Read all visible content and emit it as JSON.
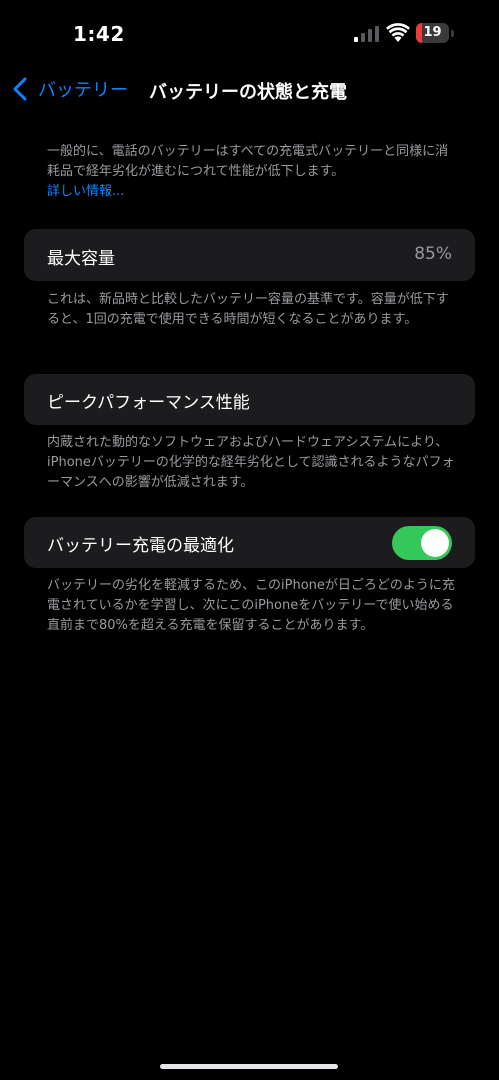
{
  "status_bar": {
    "time": "1:42",
    "battery_level": "19",
    "battery_fraction": 0.19,
    "icons": [
      "cellular-signal-icon",
      "wifi-icon",
      "battery-icon"
    ]
  },
  "nav": {
    "back_label": "バッテリー",
    "title": "バッテリーの状態と充電"
  },
  "intro": {
    "text": "一般的に、電話のバッテリーはすべての充電式バッテリーと同様に消耗品で経年劣化が進むにつれて性能が低下します。",
    "link": "詳しい情報..."
  },
  "max_capacity": {
    "label": "最大容量",
    "value": "85%",
    "footnote": "これは、新品時と比較したバッテリー容量の基準です。容量が低下すると、1回の充電で使用できる時間が短くなることがあります。"
  },
  "peak_performance": {
    "label": "ピークパフォーマンス性能",
    "footnote": "内蔵された動的なソフトウェアおよびハードウェアシステムにより、iPhoneバッテリーの化学的な経年劣化として認識されるようなパフォーマンスへの影響が低減されます。"
  },
  "optimized_charging": {
    "label": "バッテリー充電の最適化",
    "enabled": true,
    "footnote": "バッテリーの劣化を軽減するため、このiPhoneが日ごろどのように充電されているかを学習し、次にこのiPhoneをバッテリーで使い始める直前まで80%を超える充電を保留することがあります。"
  },
  "colors": {
    "background": "#000000",
    "cell": "#1c1c1e",
    "accent_blue": "#0a84ff",
    "toggle_on": "#34c759",
    "battery_low": "#eb3b3b",
    "secondary_text": "#9a9aa0"
  }
}
